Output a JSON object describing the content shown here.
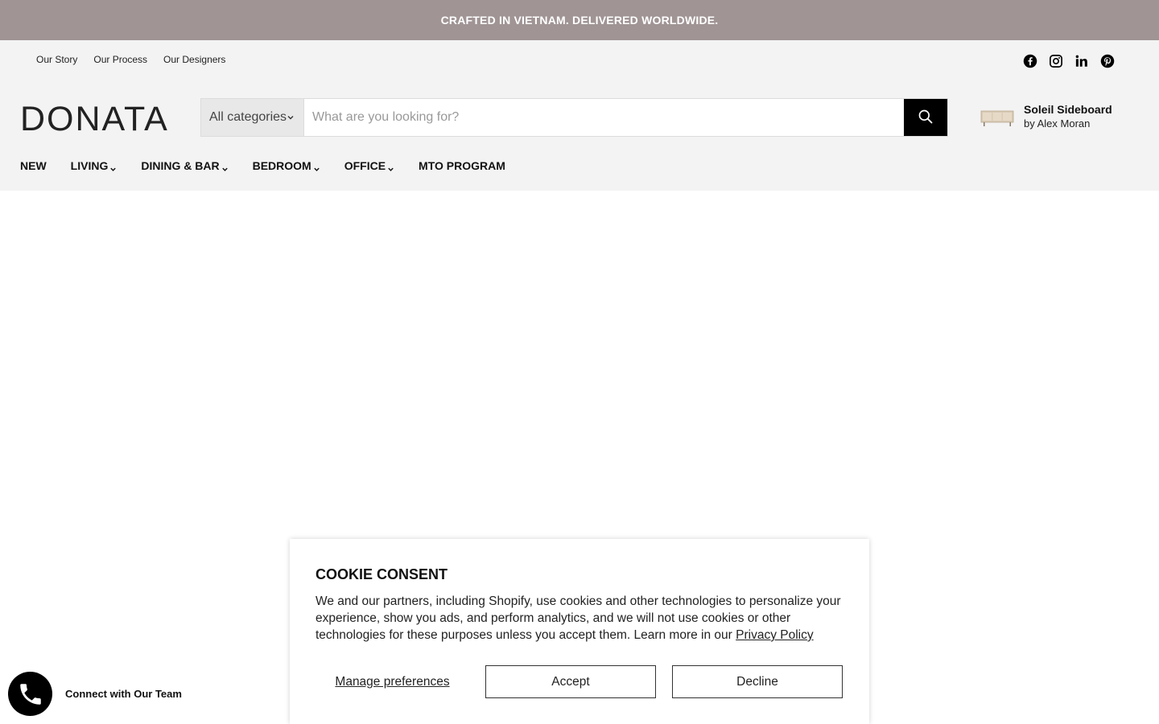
{
  "announcement": "CRAFTED IN VIETNAM. DELIVERED WORLDWIDE.",
  "top_links": [
    "Our Story",
    "Our Process",
    "Our Designers"
  ],
  "social_icons": [
    "facebook-icon",
    "instagram-icon",
    "linkedin-icon",
    "pinterest-icon"
  ],
  "logo": "DONATA",
  "search": {
    "category": "All categories",
    "placeholder": "What are you looking for?"
  },
  "featured": {
    "title": "Soleil Sideboard",
    "byline": "by Alex Moran"
  },
  "nav": {
    "new": "NEW",
    "living": "LIVING",
    "dining": "DINING & BAR",
    "bedroom": "BEDROOM",
    "office": "OFFICE",
    "mto": "MTO PROGRAM"
  },
  "cookie": {
    "title": "COOKIE CONSENT",
    "body": "We and our partners, including Shopify, use cookies and other technologies to personalize your experience, show you ads, and perform analytics, and we will not use cookies or other technologies for these purposes unless you accept them. Learn more in our ",
    "privacy_link": "Privacy Policy",
    "manage": "Manage preferences",
    "accept": "Accept",
    "decline": "Decline"
  },
  "whatsapp": {
    "label": "Connect with Our Team"
  },
  "colors": {
    "announcement_bg": "#a09494",
    "header_bg": "#f3f3f3",
    "accent": "#000000"
  }
}
